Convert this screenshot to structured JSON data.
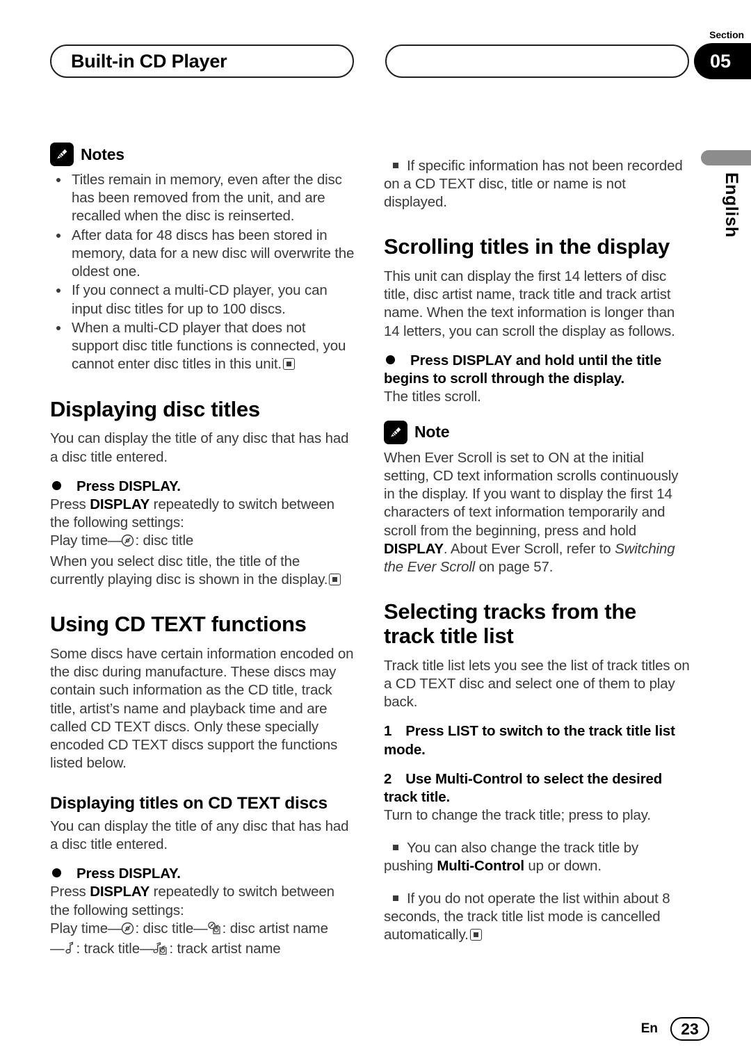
{
  "header": {
    "title": "Built-in CD Player",
    "section_label": "Section",
    "section_number": "05",
    "right_pill_text": ""
  },
  "sidebar": {
    "language": "English"
  },
  "footer": {
    "language_code": "En",
    "page_number": "23"
  },
  "left_column": {
    "notes_block": {
      "icon": "pencil-icon",
      "title": "Notes",
      "items": [
        "Titles remain in memory, even after the disc has been removed from the unit, and are recalled when the disc is reinserted.",
        "After data for 48 discs has been stored in memory, data for a new disc will overwrite the oldest one.",
        "If you connect a multi-CD player, you can input disc titles for up to 100 discs.",
        "When a multi-CD player that does not support disc title functions is connected, you cannot enter disc titles in this unit."
      ]
    },
    "displaying_disc_titles": {
      "heading": "Displaying disc titles",
      "intro": "You can display the title of any disc that has had a disc title entered.",
      "step": "Press DISPLAY.",
      "body_pre": "Press ",
      "body_bold": "DISPLAY",
      "body_post": " repeatedly to switch between the following settings:",
      "sequence_prefix": "Play time",
      "sequence_suffix": ": disc title",
      "closing": "When you select disc title, the title of the currently playing disc is shown in the display."
    },
    "using_cd_text": {
      "heading": "Using CD TEXT functions",
      "body": "Some discs have certain information encoded on the disc during manufacture. These discs may contain such information as the CD title, track title, artist’s name and playback time and are called CD TEXT discs. Only these specially encoded CD TEXT discs support the functions listed below."
    },
    "displaying_titles_cd_text": {
      "heading": "Displaying titles on CD TEXT discs",
      "intro": "You can display the title of any disc that has had a disc title entered.",
      "step": "Press DISPLAY.",
      "body_pre": "Press ",
      "body_bold": "DISPLAY",
      "body_post": " repeatedly to switch between the following settings:",
      "seq_play_time": "Play time",
      "seq_disc_title": ": disc title",
      "seq_disc_artist": ": disc artist name",
      "seq_track_title": ": track title",
      "seq_track_artist": ": track artist name"
    }
  },
  "right_column": {
    "top_note": "If specific information has not been recorded on a CD TEXT disc, title or name is not displayed.",
    "scrolling_titles": {
      "heading": "Scrolling titles in the display",
      "body": "This unit can display the first 14 letters of disc title, disc artist name, track title and track artist name. When the text information is longer than 14 letters, you can scroll the display as follows.",
      "step": "Press DISPLAY and hold until the title begins to scroll through the display.",
      "result": "The titles scroll."
    },
    "note_block": {
      "icon": "pencil-icon",
      "title": "Note",
      "part1": "When Ever Scroll is set to ON at the initial setting, CD text information scrolls continuously in the display. If you want to display the first 14 characters of text information temporarily and scroll from the beginning, press and hold ",
      "bold1": "DISPLAY",
      "part2": ". About Ever Scroll, refer to ",
      "italic1": "Switching the Ever Scroll",
      "part3": " on page 57."
    },
    "selecting_tracks": {
      "heading": "Selecting tracks from the track title list",
      "intro": "Track title list lets you see the list of track titles on a CD TEXT disc and select one of them to play back.",
      "step1_num": "1",
      "step1": "Press LIST to switch to the track title list mode.",
      "step2_num": "2",
      "step2": "Use Multi-Control to select the desired track title.",
      "step2_result": "Turn to change the track title; press to play.",
      "sub1_pre": "You can also change the track title by pushing ",
      "sub1_bold": "Multi-Control",
      "sub1_post": " up or down.",
      "sub2": "If you do not operate the list within about 8 seconds, the track title list mode is cancelled automatically."
    }
  }
}
